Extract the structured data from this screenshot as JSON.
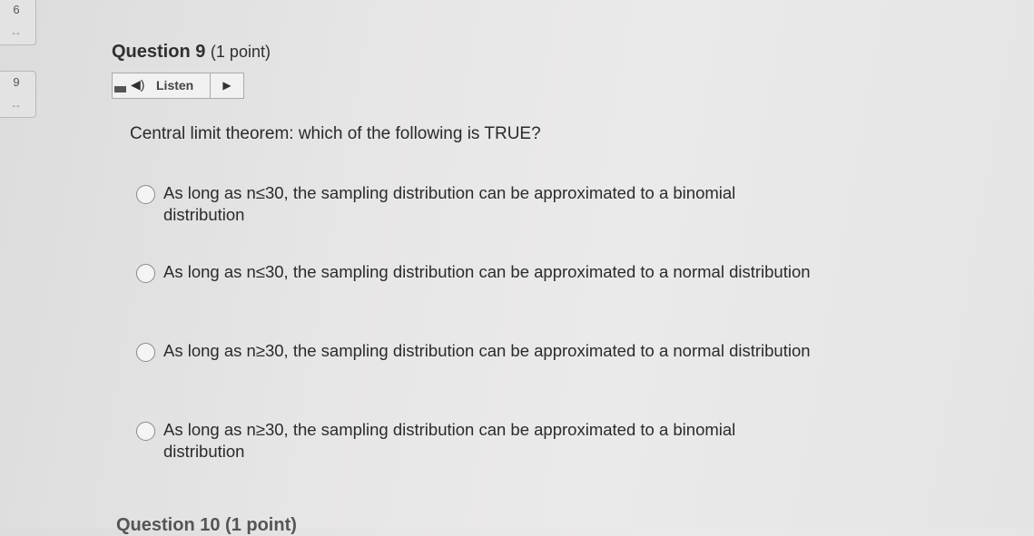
{
  "nav": {
    "items": [
      {
        "number": "6",
        "status": "--"
      },
      {
        "number": "9",
        "status": "--"
      }
    ]
  },
  "question": {
    "title": "Question 9",
    "points": "(1 point)",
    "listen_label": "Listen",
    "prompt": "Central limit theorem: which of the following is TRUE?",
    "options": [
      "As long as n≤30, the sampling distribution can be approximated to a binomial distribution",
      "As long as n≤30, the sampling distribution can be approximated to a normal distribution",
      "As long as n≥30, the sampling distribution can be approximated to a normal distribution",
      "As long as n≥30, the sampling distribution can be approximated to a binomial distribution"
    ]
  },
  "next_question": {
    "title": "Question 10 (1 point)"
  }
}
